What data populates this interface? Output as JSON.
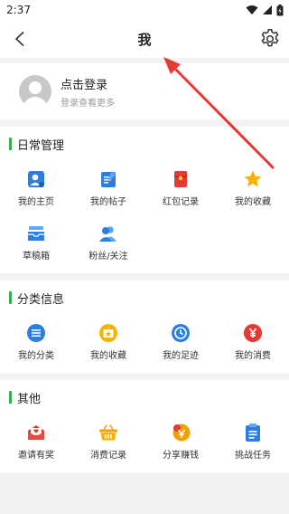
{
  "status_bar": {
    "time": "2:37"
  },
  "header": {
    "title": "我"
  },
  "profile": {
    "name": "点击登录",
    "subtitle": "登录查看更多"
  },
  "sections": [
    {
      "title": "日常管理",
      "items": [
        {
          "label": "我的主页",
          "icon": "user-card-icon"
        },
        {
          "label": "我的帖子",
          "icon": "post-edit-icon"
        },
        {
          "label": "红包记录",
          "icon": "red-envelope-icon"
        },
        {
          "label": "我的收藏",
          "icon": "star-icon"
        },
        {
          "label": "草稿箱",
          "icon": "inbox-icon"
        },
        {
          "label": "粉丝/关注",
          "icon": "fans-icon"
        }
      ]
    },
    {
      "title": "分类信息",
      "items": [
        {
          "label": "我的分类",
          "icon": "list-icon"
        },
        {
          "label": "我的收藏",
          "icon": "favorite-box-icon"
        },
        {
          "label": "我的足迹",
          "icon": "clock-icon"
        },
        {
          "label": "我的消费",
          "icon": "yen-icon"
        }
      ]
    },
    {
      "title": "其他",
      "items": [
        {
          "label": "邀请有奖",
          "icon": "invite-envelope-icon"
        },
        {
          "label": "消费记录",
          "icon": "shopping-basket-icon"
        },
        {
          "label": "分享赚钱",
          "icon": "share-coin-icon"
        },
        {
          "label": "挑战任务",
          "icon": "clipboard-task-icon"
        }
      ]
    }
  ],
  "colors": {
    "accent_green": "#2bb44a",
    "annotation_arrow": "#e53935"
  }
}
